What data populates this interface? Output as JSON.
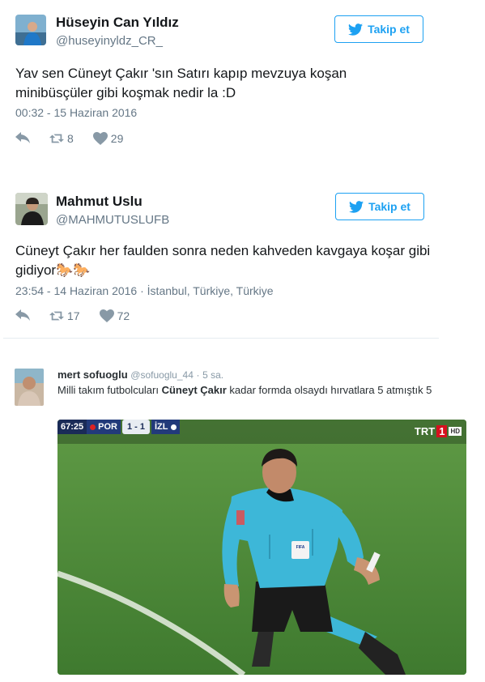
{
  "tweets": [
    {
      "user_name": "Hüseyin Can Yıldız",
      "handle": "@huseyinyldz_CR_",
      "follow_label": "Takip et",
      "text": "Yav sen Cüneyt Çakır 'sın Satırı kapıp mevzuya koşan minibüsçüler gibi koşmak nedir la :D",
      "timestamp": "00:32 - 15 Haziran 2016",
      "retweets": "8",
      "likes": "29"
    },
    {
      "user_name": "Mahmut Uslu",
      "handle": "@MAHMUTUSLUFB",
      "follow_label": "Takip et",
      "text": "Cüneyt Çakır her faulden sonra neden kahveden kavgaya koşar gibi gidiyor🐎🐎",
      "timestamp": "23:54 - 14 Haziran 2016",
      "location": "İstanbul, Türkiye, Türkiye",
      "retweets": "17",
      "likes": "72"
    }
  ],
  "tweet3": {
    "user_name": "mert sofuoglu",
    "handle": "@sofuoglu_44",
    "time_ago": "5 sa.",
    "text_before": "Milli takım futbolcuları ",
    "text_bold": "Cüneyt Çakır",
    "text_after": " kadar formda olsaydı hırvatlara 5 atmıştık 5",
    "media": {
      "match_time": "67:25",
      "team_home": "POR",
      "score": "1 - 1",
      "team_away": "İZL",
      "channel": "TRT",
      "channel_num": "1",
      "channel_hd": "HD",
      "badge_text": "FIFA"
    }
  },
  "colors": {
    "accent": "#1da1f2",
    "muted": "#657786",
    "pitch": "#4e8a3a",
    "shirt": "#3db7d8"
  }
}
